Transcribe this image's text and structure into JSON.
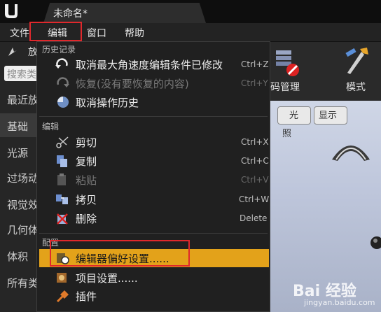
{
  "window": {
    "tab_title": "未命名*"
  },
  "menubar": {
    "items": [
      "文件",
      "编辑",
      "窗口",
      "帮助"
    ]
  },
  "left_panel": {
    "title": "放",
    "search_placeholder": "搜索类",
    "categories": [
      "最近放",
      "基础",
      "光源",
      "过场动",
      "视觉效",
      "几何体",
      "体积",
      "所有类"
    ]
  },
  "toolbar": {
    "code_label": "码管理",
    "mode_label": "模式"
  },
  "viewport": {
    "lit_button": "光照",
    "show_button": "显示"
  },
  "dropdown": {
    "sections": {
      "history": "历史记录",
      "edit": "编辑",
      "config": "配置"
    },
    "history_items": [
      {
        "label": "取消最大角速度编辑条件已修改",
        "shortcut": "Ctrl+Z",
        "enabled": true,
        "icon": "undo-icon"
      },
      {
        "label": "恢复(没有要恢复的内容)",
        "shortcut": "Ctrl+Y",
        "enabled": false,
        "icon": "redo-icon"
      },
      {
        "label": "取消操作历史",
        "shortcut": "",
        "enabled": true,
        "icon": "undo-history-icon"
      }
    ],
    "edit_items": [
      {
        "label": "剪切",
        "shortcut": "Ctrl+X",
        "enabled": true,
        "icon": "scissors-icon"
      },
      {
        "label": "复制",
        "shortcut": "Ctrl+C",
        "enabled": true,
        "icon": "copy-icon"
      },
      {
        "label": "粘贴",
        "shortcut": "Ctrl+V",
        "enabled": false,
        "icon": "paste-icon"
      },
      {
        "label": "拷贝",
        "shortcut": "Ctrl+W",
        "enabled": true,
        "icon": "duplicate-icon"
      },
      {
        "label": "删除",
        "shortcut": "Delete",
        "enabled": true,
        "icon": "delete-icon"
      }
    ],
    "config_items": [
      {
        "label": "编辑器偏好设置......",
        "shortcut": "",
        "enabled": true,
        "icon": "editor-preferences-icon",
        "highlighted": true
      },
      {
        "label": "项目设置......",
        "shortcut": "",
        "enabled": true,
        "icon": "project-settings-icon"
      },
      {
        "label": "插件",
        "shortcut": "",
        "enabled": true,
        "icon": "plugin-icon"
      }
    ]
  },
  "watermark": {
    "logo": "Bai 经验",
    "url": "jingyan.baidu.com"
  },
  "colors": {
    "highlight": "#e3a21a",
    "annotation_red": "#e0282c"
  }
}
